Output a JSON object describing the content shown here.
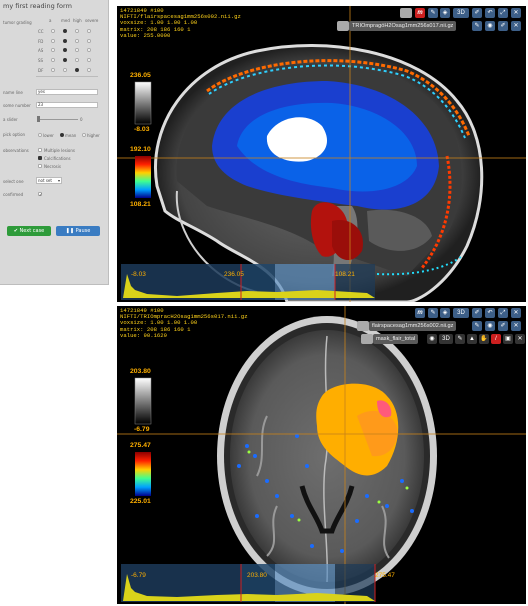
{
  "form": {
    "title": "my first reading form",
    "grading_label": "tumor grading",
    "grid_headers": [
      "a",
      "med",
      "high",
      "severe"
    ],
    "grid_rows": [
      "CC",
      "FD",
      "AS",
      "SS",
      "DF"
    ],
    "field1_label": "name line",
    "field1_value": "yes",
    "field2_label": "some number",
    "field2_value": "23",
    "slider_label": "a slider",
    "slider_value": "0",
    "radio_label": "pick option",
    "radio_options": [
      "lower",
      "mean",
      "higher"
    ],
    "check_label": "observations",
    "check_options": [
      "Multiple lesions",
      "Calcifications",
      "Necrosis"
    ],
    "select_label": "select one",
    "select_value": "not set",
    "confirm_label": "confirmed",
    "next_button": "Next case",
    "pause_button": "Pause"
  },
  "viewer1": {
    "info": [
      "14721849 #100",
      "NIFTI/flairspacesag1mm256s002.nii.gz",
      "voxsize: 1.00 1.00 1.00",
      "matrix: 208 186 160 1",
      "value: 255.0000"
    ],
    "tools": [
      "m",
      "3D"
    ],
    "layer_name": "TRIOmpragóH2Osag1mm256s017.nii.gz",
    "cbar1_max": "236.05",
    "cbar1_min": "-8.03",
    "cbar2_max": "192.10",
    "cbar2_min": "108.21",
    "hist_labels": [
      "-8.03",
      "236.05",
      "108.21"
    ]
  },
  "viewer2": {
    "info": [
      "14721849 #100",
      "NIFTI/TRIOmpracH2Osag1mm256s017.nii.gz",
      "voxsize: 1.00 1.00 1.00",
      "matrix: 208 186 160 1",
      "value: 90.1629"
    ],
    "tools": [
      "m",
      "3D"
    ],
    "layer1_name": "flairspacesag1mm256s002.nii.gz",
    "layer2_name": "mask_flair_total",
    "layer2_tool": "3D",
    "cbar1_max": "203.80",
    "cbar1_min": "-6.79",
    "cbar2_max": "275.47",
    "cbar2_min": "225.01",
    "hist_labels": [
      "-6.79",
      "203.80",
      "275.47"
    ]
  },
  "colors": {
    "accent": "#3d5f88",
    "cbar_label": "#ffb000",
    "info_text": "#ffd21a",
    "red_tool": "#cc1f1f",
    "green_button": "#2e9b3a",
    "blue_button": "#3a7cc2"
  }
}
